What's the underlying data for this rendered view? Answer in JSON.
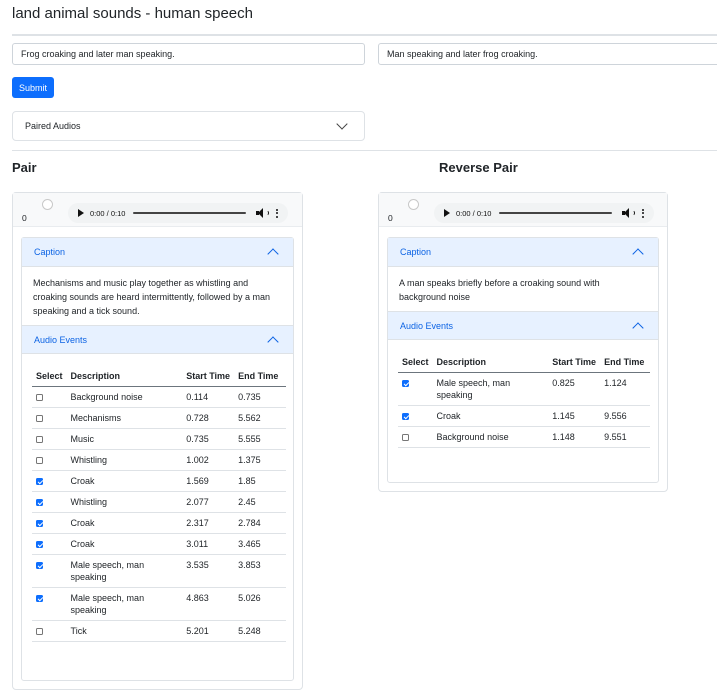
{
  "title": "land animal sounds - human speech",
  "inputs": {
    "left_value": "Frog croaking and later man speaking.",
    "right_value": "Man speaking and later frog croaking."
  },
  "submit_label": "Submit",
  "dropdown_label": "Paired Audios",
  "pair": {
    "title": "Pair",
    "index": "0",
    "player_time": "0:00 / 0:10",
    "caption_header": "Caption",
    "caption_text": "Mechanisms and music play together as whistling and croaking sounds are heard intermittently, followed by a man speaking and a tick sound.",
    "events_header": "Audio Events",
    "columns": [
      "Select",
      "Description",
      "Start Time",
      "End Time"
    ],
    "rows": [
      {
        "checked": false,
        "description": "Background noise",
        "start": "0.114",
        "end": "0.735"
      },
      {
        "checked": false,
        "description": "Mechanisms",
        "start": "0.728",
        "end": "5.562"
      },
      {
        "checked": false,
        "description": "Music",
        "start": "0.735",
        "end": "5.555"
      },
      {
        "checked": false,
        "description": "Whistling",
        "start": "1.002",
        "end": "1.375"
      },
      {
        "checked": true,
        "description": "Croak",
        "start": "1.569",
        "end": "1.85"
      },
      {
        "checked": true,
        "description": "Whistling",
        "start": "2.077",
        "end": "2.45"
      },
      {
        "checked": true,
        "description": "Croak",
        "start": "2.317",
        "end": "2.784"
      },
      {
        "checked": true,
        "description": "Croak",
        "start": "3.011",
        "end": "3.465"
      },
      {
        "checked": true,
        "description": "Male speech, man speaking",
        "start": "3.535",
        "end": "3.853"
      },
      {
        "checked": true,
        "description": "Male speech, man speaking",
        "start": "4.863",
        "end": "5.026"
      },
      {
        "checked": false,
        "description": "Tick",
        "start": "5.201",
        "end": "5.248"
      }
    ]
  },
  "reverse": {
    "title": "Reverse Pair",
    "index": "0",
    "player_time": "0:00 / 0:10",
    "caption_header": "Caption",
    "caption_text": "A man speaks briefly before a croaking sound with background noise",
    "events_header": "Audio Events",
    "columns": [
      "Select",
      "Description",
      "Start Time",
      "End Time"
    ],
    "rows": [
      {
        "checked": true,
        "description": "Male speech, man speaking",
        "start": "0.825",
        "end": "1.124"
      },
      {
        "checked": true,
        "description": "Croak",
        "start": "1.145",
        "end": "9.556"
      },
      {
        "checked": false,
        "description": "Background noise",
        "start": "1.148",
        "end": "9.551"
      }
    ]
  },
  "colors": {
    "accent": "#0d6efd",
    "accordion_header_bg": "#e7f1ff",
    "accordion_header_text": "#0c63e4"
  }
}
